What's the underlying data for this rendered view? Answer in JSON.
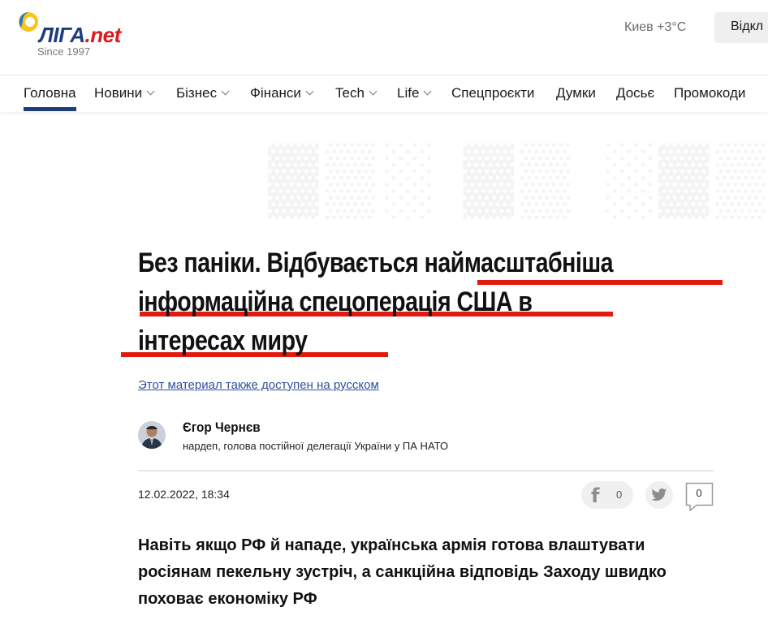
{
  "header": {
    "logo_main": "ЛІГА",
    "logo_suffix": ".net",
    "since": "Since 1997",
    "weather": "Киев +3°C",
    "open_button": "Відкл"
  },
  "nav": {
    "items": [
      {
        "label": "Головна",
        "dropdown": false,
        "active": true
      },
      {
        "label": "Новини",
        "dropdown": true
      },
      {
        "label": "Бізнес",
        "dropdown": true
      },
      {
        "label": "Фінанси",
        "dropdown": true
      },
      {
        "label": "Tech",
        "dropdown": true
      },
      {
        "label": "Life",
        "dropdown": true
      },
      {
        "label": "Спецпроєкти",
        "dropdown": false
      },
      {
        "label": "Думки",
        "dropdown": false
      },
      {
        "label": "Досьє",
        "dropdown": false
      },
      {
        "label": "Промокоди",
        "dropdown": false
      }
    ]
  },
  "article": {
    "title_line1": "Без паніки. Відбувається наймасштабніша",
    "title_line2": "інформаційна спецоперація США в",
    "title_line3": "інтересах миру",
    "lang_link": "Этот материал также доступен на русском",
    "author_name": "Єгор Чернєв",
    "author_role": "нардеп, голова постійної делегації України у ПА НАТО",
    "date": "12.02.2022, 18:34",
    "lead": "Навіть якщо РФ й нападе, українська армія готова влаштувати росіянам пекельну зустріч, а санкційна відповідь Заходу швидко поховає економіку РФ"
  },
  "share": {
    "facebook_count": "0",
    "comments_count": "0"
  },
  "colors": {
    "brand_blue": "#1c3f7c",
    "brand_red": "#e0171b",
    "underline_red": "#e3180f",
    "link_blue": "#2f4f9b"
  }
}
